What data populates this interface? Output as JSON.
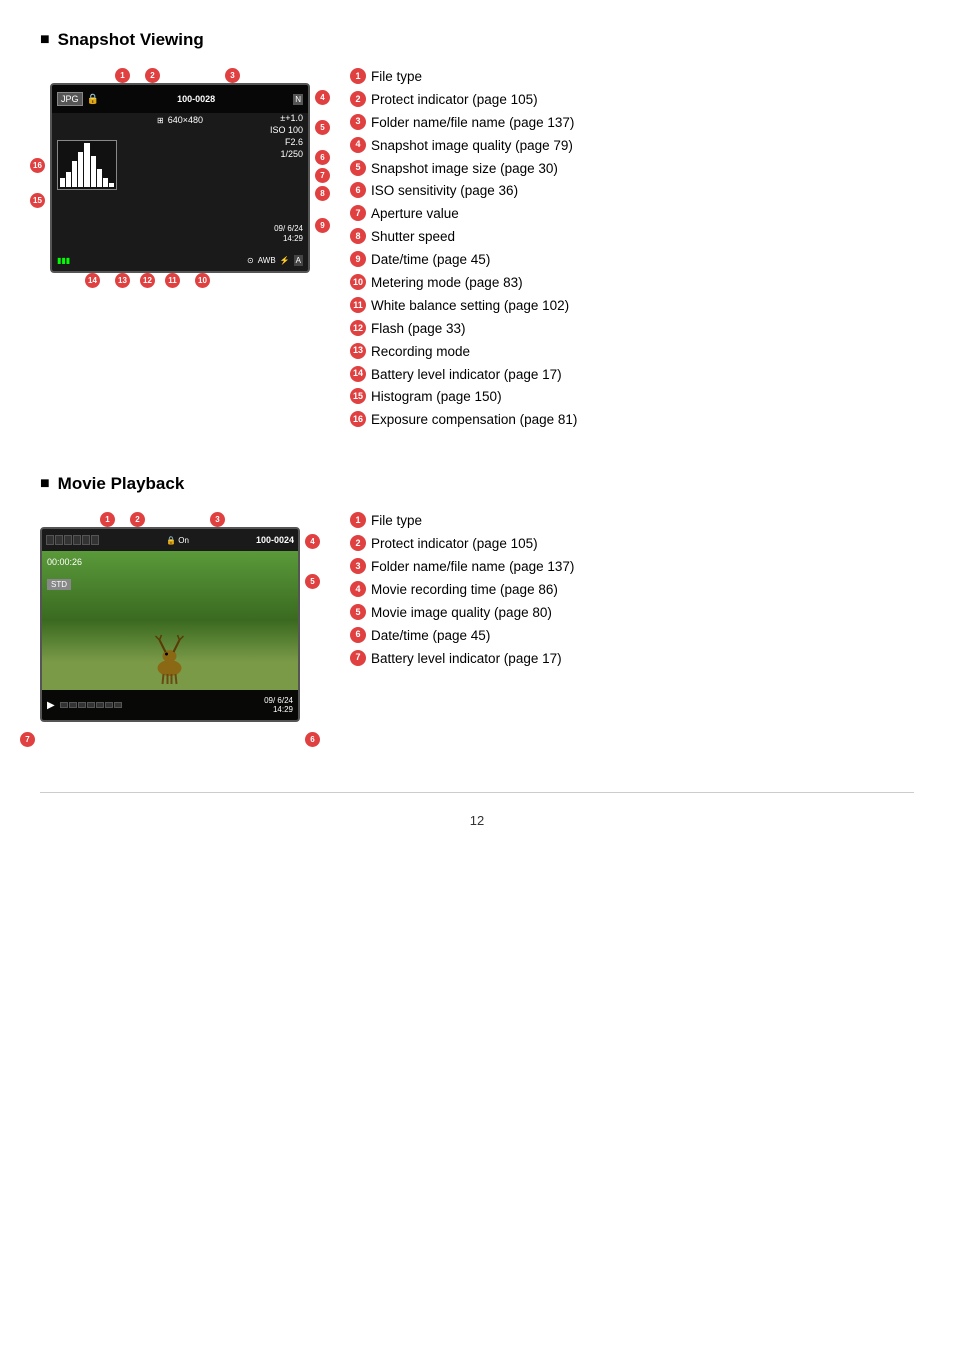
{
  "page": {
    "number": "12"
  },
  "snapshot_section": {
    "title": "Snapshot Viewing",
    "display": {
      "folder": "100-0028",
      "resolution": "640×480",
      "ev": "±+1.0",
      "iso": "ISO 100",
      "aperture": "F2.6",
      "shutter": "1/250",
      "date": "09/ 6/24",
      "time": "14:29"
    },
    "items": [
      {
        "num": "1",
        "text": "File type"
      },
      {
        "num": "2",
        "text": "Protect indicator (page 105)"
      },
      {
        "num": "3",
        "text": "Folder name/file name (page 137)"
      },
      {
        "num": "4",
        "text": "Snapshot image quality (page 79)"
      },
      {
        "num": "5",
        "text": "Snapshot image size (page 30)"
      },
      {
        "num": "6",
        "text": "ISO sensitivity (page 36)"
      },
      {
        "num": "7",
        "text": "Aperture value"
      },
      {
        "num": "8",
        "text": "Shutter speed"
      },
      {
        "num": "9",
        "text": "Date/time (page 45)"
      },
      {
        "num": "10",
        "text": "Metering mode (page 83)"
      },
      {
        "num": "11",
        "text": "White balance setting (page 102)"
      },
      {
        "num": "12",
        "text": "Flash (page 33)"
      },
      {
        "num": "13",
        "text": "Recording mode"
      },
      {
        "num": "14",
        "text": "Battery level indicator (page 17)"
      },
      {
        "num": "15",
        "text": "Histogram (page 150)"
      },
      {
        "num": "16",
        "text": "Exposure compensation (page 81)"
      }
    ]
  },
  "movie_section": {
    "title": "Movie Playback",
    "display": {
      "folder": "100-0024",
      "time": "00:00:26",
      "quality": "STD",
      "date": "09/ 6/24",
      "datetime2": "14:29"
    },
    "items": [
      {
        "num": "1",
        "text": "File type"
      },
      {
        "num": "2",
        "text": "Protect indicator (page 105)"
      },
      {
        "num": "3",
        "text": "Folder name/file name (page 137)"
      },
      {
        "num": "4",
        "text": "Movie recording time (page 86)"
      },
      {
        "num": "5",
        "text": "Movie image quality (page 80)"
      },
      {
        "num": "6",
        "text": "Date/time (page 45)"
      },
      {
        "num": "7",
        "text": "Battery level indicator (page 17)"
      }
    ]
  }
}
